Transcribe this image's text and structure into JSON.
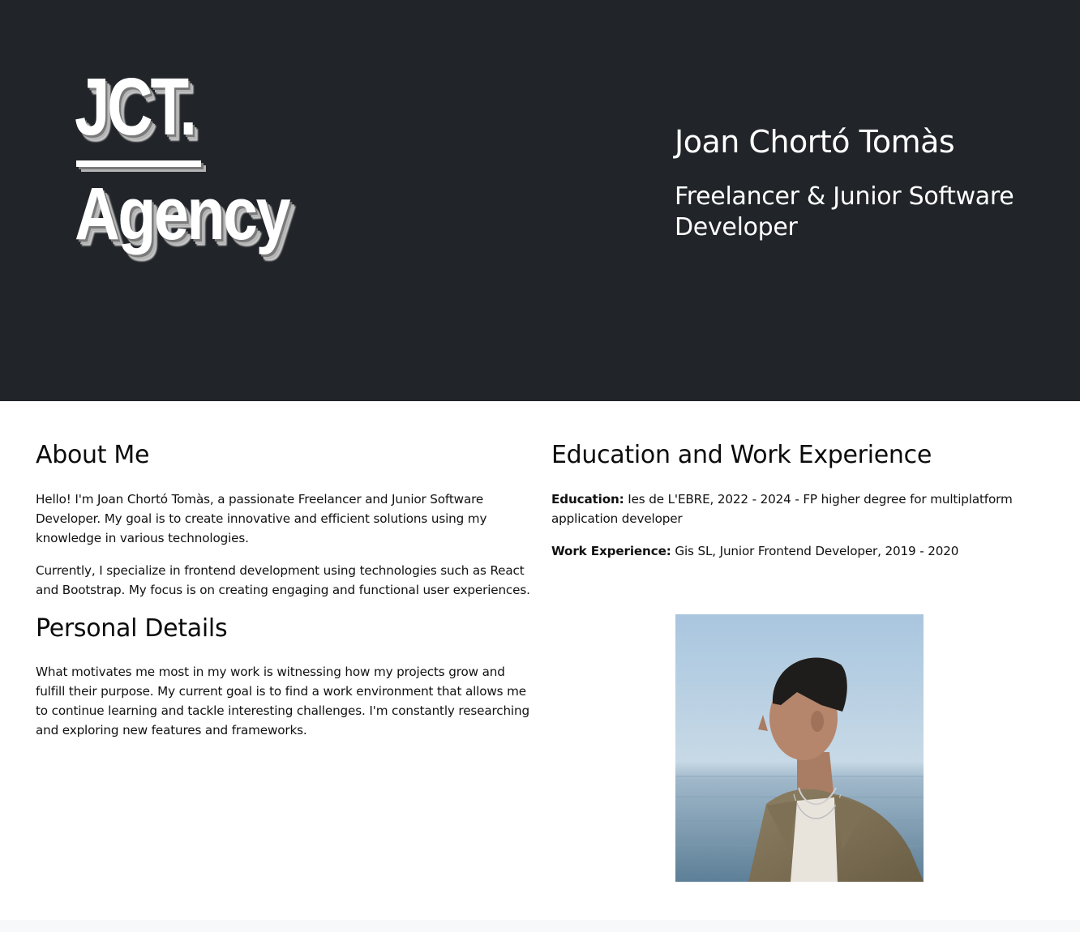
{
  "hero": {
    "logo_line1": "JCT.",
    "logo_line2": "Agency",
    "name": "Joan Chortó Tomàs",
    "role": "Freelancer & Junior Software Developer"
  },
  "about": {
    "title": "About Me",
    "paragraphs": [
      "Hello! I'm Joan Chortó Tomàs, a passionate Freelancer and Junior Software Developer. My goal is to create innovative and efficient solutions using my knowledge in various technologies.",
      "Currently, I specialize in frontend development using technologies such as React and Bootstrap. My focus is on creating engaging and functional user experiences."
    ]
  },
  "personal": {
    "title": "Personal Details",
    "paragraph": "What motivates me most in my work is witnessing how my projects grow and fulfill their purpose. My current goal is to find a work environment that allows me to continue learning and tackle interesting challenges. I'm constantly researching and exploring new features and frameworks."
  },
  "education_work": {
    "title": "Education and Work Experience",
    "education_label": "Education:",
    "education_value": " Ies de L'EBRE, 2022 - 2024 - FP higher degree for multiplatform application developer",
    "work_label": "Work Experience:",
    "work_value": " Gis SL, Junior Frontend Developer, 2019 - 2020"
  },
  "colors": {
    "hero_bg": "#212428",
    "text": "#111111",
    "footer_bg": "#f7f8fa"
  },
  "icons": {
    "photo": "profile-photo"
  }
}
